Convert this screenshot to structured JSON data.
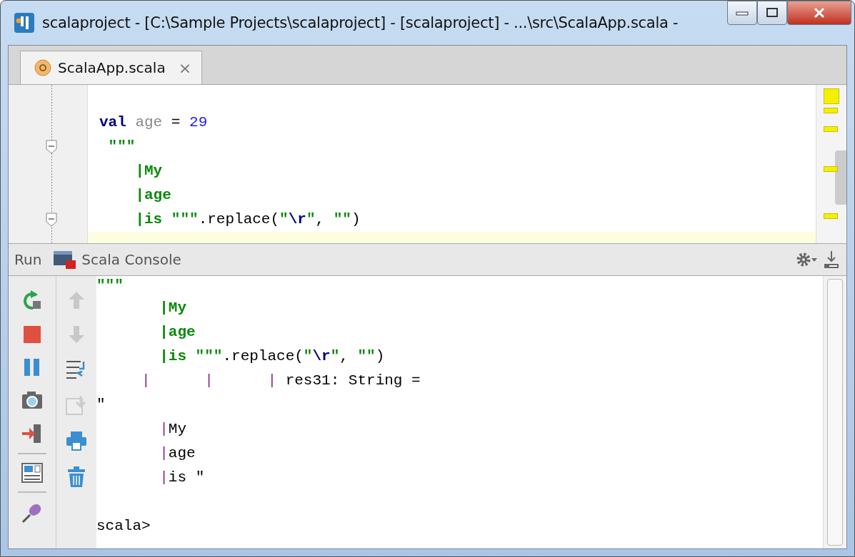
{
  "window": {
    "title": "scalaproject - [C:\\Sample Projects\\scalaproject] - [scalaproject] - ...\\src\\ScalaApp.scala -"
  },
  "tabs": [
    {
      "label": "ScalaApp.scala",
      "selected": true,
      "close": "×"
    }
  ],
  "editor": {
    "lines": [
      {
        "current": false,
        "fold": false
      },
      {
        "current": false,
        "fold": false,
        "segments": [
          {
            "kind": "keyword",
            "t": "val"
          },
          {
            "kind": "dim",
            "t": " age"
          },
          {
            "kind": "plain",
            "t": " = "
          },
          {
            "kind": "number",
            "t": "29"
          }
        ]
      },
      {
        "current": false,
        "fold": true,
        "segments": [
          {
            "kind": "string",
            "t": " \"\"\""
          }
        ]
      },
      {
        "current": false,
        "fold": false,
        "segments": [
          {
            "kind": "string",
            "t": "    |My"
          }
        ]
      },
      {
        "current": false,
        "fold": false,
        "segments": [
          {
            "kind": "string",
            "t": "    |age"
          }
        ]
      },
      {
        "current": false,
        "fold": true,
        "segments": [
          {
            "kind": "string",
            "t": "    |is \"\"\""
          },
          {
            "kind": "plain",
            "t": ".replace("
          },
          {
            "kind": "string",
            "t": "\""
          },
          {
            "kind": "escape",
            "t": "\\r"
          },
          {
            "kind": "string",
            "t": "\""
          },
          {
            "kind": "plain",
            "t": ", "
          },
          {
            "kind": "string",
            "t": "\"\""
          },
          {
            "kind": "plain",
            "t": ")"
          }
        ]
      },
      {
        "current": true,
        "fold": false
      }
    ]
  },
  "tool_window": {
    "label": "Run",
    "tab": "Scala Console"
  },
  "console": {
    "lines": [
      [
        {
          "kind": "string",
          "t": "\"\"\""
        }
      ],
      [
        {
          "kind": "string",
          "t": "       |My"
        }
      ],
      [
        {
          "kind": "string",
          "t": "       |age"
        }
      ],
      [
        {
          "kind": "string",
          "t": "       |is \"\"\""
        },
        {
          "kind": "plain",
          "t": ".replace("
        },
        {
          "kind": "string",
          "t": "\""
        },
        {
          "kind": "escape",
          "t": "\\r"
        },
        {
          "kind": "string",
          "t": "\""
        },
        {
          "kind": "plain",
          "t": ", "
        },
        {
          "kind": "string",
          "t": "\"\""
        },
        {
          "kind": "plain",
          "t": ")"
        }
      ],
      [
        {
          "kind": "pipe",
          "t": "     |      |      |"
        },
        {
          "kind": "plain",
          "t": " res31: String ="
        }
      ],
      [
        {
          "kind": "plain",
          "t": "\""
        }
      ],
      [
        {
          "kind": "pipe",
          "t": "       |"
        },
        {
          "kind": "plain",
          "t": "My"
        }
      ],
      [
        {
          "kind": "pipe",
          "t": "       |"
        },
        {
          "kind": "plain",
          "t": "age"
        }
      ],
      [
        {
          "kind": "pipe",
          "t": "       |"
        },
        {
          "kind": "plain",
          "t": "is \""
        }
      ],
      [
        {
          "kind": "prompt",
          "t": "scala>"
        }
      ]
    ]
  }
}
